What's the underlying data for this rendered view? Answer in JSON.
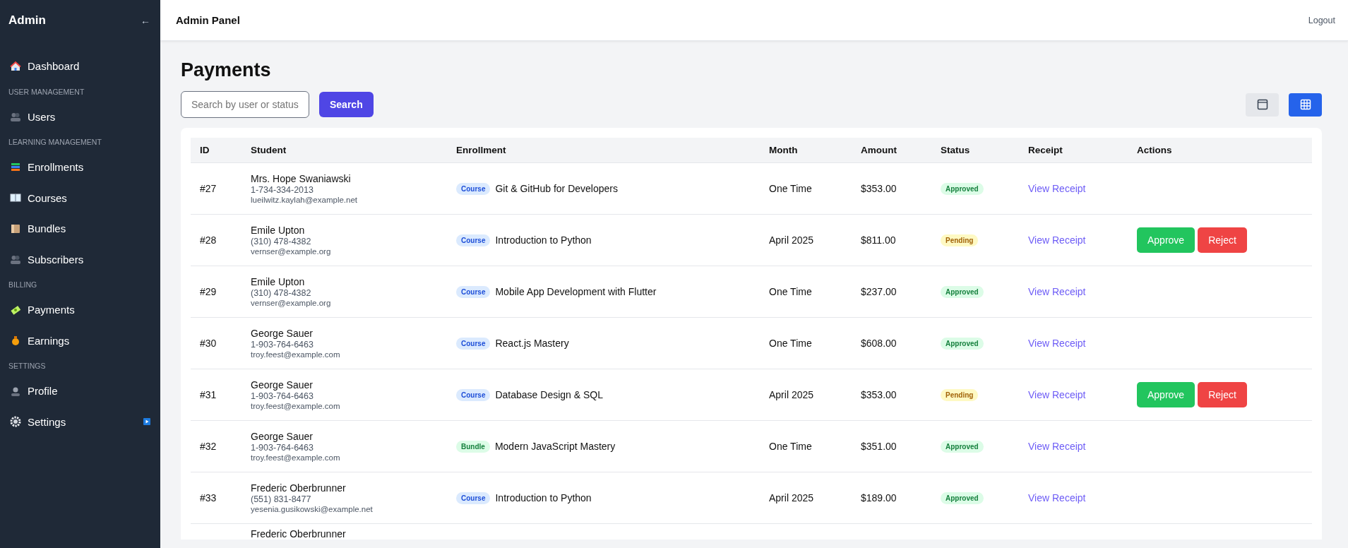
{
  "sidebar": {
    "title": "Admin",
    "collapse_glyph": "←",
    "items": [
      {
        "kind": "item",
        "label": "Dashboard",
        "badge": false
      },
      {
        "kind": "heading",
        "label": "USER MANAGEMENT"
      },
      {
        "kind": "item",
        "label": "Users",
        "badge": false
      },
      {
        "kind": "heading",
        "label": "LEARNING MANAGEMENT"
      },
      {
        "kind": "item",
        "label": "Enrollments",
        "badge": false
      },
      {
        "kind": "item",
        "label": "Courses",
        "badge": false
      },
      {
        "kind": "item",
        "label": "Bundles",
        "badge": false
      },
      {
        "kind": "item",
        "label": "Subscribers",
        "badge": false
      },
      {
        "kind": "heading",
        "label": "BILLING"
      },
      {
        "kind": "item",
        "label": "Payments",
        "badge": false
      },
      {
        "kind": "item",
        "label": "Earnings",
        "badge": false
      },
      {
        "kind": "heading",
        "label": "SETTINGS"
      },
      {
        "kind": "item",
        "label": "Profile",
        "badge": false
      },
      {
        "kind": "item",
        "label": "Settings",
        "badge": true
      }
    ]
  },
  "topbar": {
    "title": "Admin Panel",
    "logout": "Logout"
  },
  "page": {
    "title": "Payments",
    "search": {
      "placeholder": "Search by user or status"
    },
    "search_button": "Search",
    "view_toggle": [
      {
        "kind": "card",
        "selected": false
      },
      {
        "kind": "table",
        "selected": true
      }
    ]
  },
  "table": {
    "columns": [
      "ID",
      "Student",
      "Enrollment",
      "Month",
      "Amount",
      "Status",
      "Receipt",
      "Actions"
    ],
    "rows": [
      {
        "id": "#27",
        "name": "Mrs. Hope Swaniawski",
        "phone": "1-734-334-2013",
        "email": "lueilwitz.kaylah@example.net",
        "tag": {
          "kind": "course",
          "label": "Course"
        },
        "enrollment": "Git & GitHub for Developers",
        "month": "One Time",
        "amount": "$353.00",
        "status": {
          "kind": "approved",
          "label": "Approved"
        },
        "receipt": "View Receipt",
        "actions": []
      },
      {
        "id": "#28",
        "name": "Emile Upton",
        "phone": "(310) 478-4382",
        "email": "vernser@example.org",
        "tag": {
          "kind": "course",
          "label": "Course"
        },
        "enrollment": "Introduction to Python",
        "month": "April 2025",
        "amount": "$811.00",
        "status": {
          "kind": "pending",
          "label": "Pending"
        },
        "receipt": "View Receipt",
        "actions": [
          {
            "kind": "approve",
            "label": "Approve"
          },
          {
            "kind": "reject",
            "label": "Reject"
          }
        ]
      },
      {
        "id": "#29",
        "name": "Emile Upton",
        "phone": "(310) 478-4382",
        "email": "vernser@example.org",
        "tag": {
          "kind": "course",
          "label": "Course"
        },
        "enrollment": "Mobile App Development with Flutter",
        "month": "One Time",
        "amount": "$237.00",
        "status": {
          "kind": "approved",
          "label": "Approved"
        },
        "receipt": "View Receipt",
        "actions": []
      },
      {
        "id": "#30",
        "name": "George Sauer",
        "phone": "1-903-764-6463",
        "email": "troy.feest@example.com",
        "tag": {
          "kind": "course",
          "label": "Course"
        },
        "enrollment": "React.js Mastery",
        "month": "One Time",
        "amount": "$608.00",
        "status": {
          "kind": "approved",
          "label": "Approved"
        },
        "receipt": "View Receipt",
        "actions": []
      },
      {
        "id": "#31",
        "name": "George Sauer",
        "phone": "1-903-764-6463",
        "email": "troy.feest@example.com",
        "tag": {
          "kind": "course",
          "label": "Course"
        },
        "enrollment": "Database Design & SQL",
        "month": "April 2025",
        "amount": "$353.00",
        "status": {
          "kind": "pending",
          "label": "Pending"
        },
        "receipt": "View Receipt",
        "actions": [
          {
            "kind": "approve",
            "label": "Approve"
          },
          {
            "kind": "reject",
            "label": "Reject"
          }
        ]
      },
      {
        "id": "#32",
        "name": "George Sauer",
        "phone": "1-903-764-6463",
        "email": "troy.feest@example.com",
        "tag": {
          "kind": "bundle",
          "label": "Bundle"
        },
        "enrollment": "Modern JavaScript Mastery",
        "month": "One Time",
        "amount": "$351.00",
        "status": {
          "kind": "approved",
          "label": "Approved"
        },
        "receipt": "View Receipt",
        "actions": []
      },
      {
        "id": "#33",
        "name": "Frederic Oberbrunner",
        "phone": "(551) 831-8477",
        "email": "yesenia.gusikowski@example.net",
        "tag": {
          "kind": "course",
          "label": "Course"
        },
        "enrollment": "Introduction to Python",
        "month": "April 2025",
        "amount": "$189.00",
        "status": {
          "kind": "approved",
          "label": "Approved"
        },
        "receipt": "View Receipt",
        "actions": []
      }
    ],
    "partial_row": {
      "name": "Frederic Oberbrunner"
    }
  }
}
